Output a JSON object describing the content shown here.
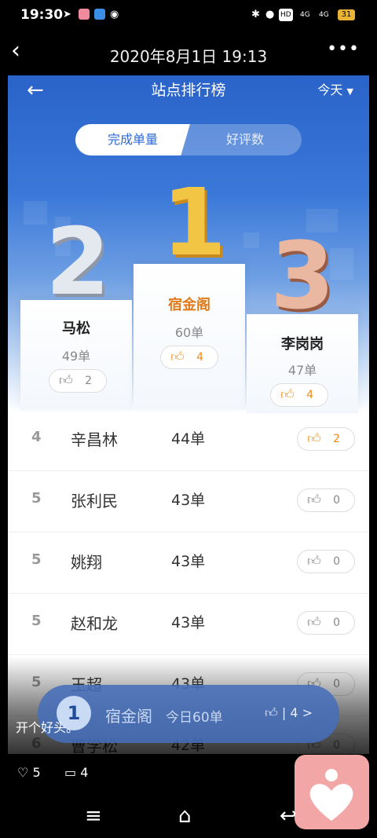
{
  "status_bar": {
    "time": "19:30",
    "network": "4G",
    "network2": "4G",
    "battery": "31",
    "hd": "HD"
  },
  "post_header": {
    "back_icon": "chevron-left-icon",
    "title": "2020年8月1日 19:13",
    "more_icon": "more-dots-icon"
  },
  "app": {
    "back_icon": "arrow-left-icon",
    "title": "站点排行榜",
    "period": "今天",
    "tabs": [
      {
        "label": "完成单量",
        "active": true
      },
      {
        "label": "好评数",
        "active": false
      }
    ],
    "podium": [
      {
        "rank": "2",
        "name": "马松",
        "count": "49单",
        "likes": "2",
        "liked": false
      },
      {
        "rank": "1",
        "name": "宿金阁",
        "count": "60单",
        "likes": "4",
        "liked": true
      },
      {
        "rank": "3",
        "name": "李岗岗",
        "count": "47单",
        "likes": "4",
        "liked": true
      }
    ],
    "rows": [
      {
        "rank": "4",
        "name": "辛昌林",
        "count": "44单",
        "likes": "2",
        "liked": true
      },
      {
        "rank": "5",
        "name": "张利民",
        "count": "43单",
        "likes": "0",
        "liked": false
      },
      {
        "rank": "5",
        "name": "姚翔",
        "count": "43单",
        "likes": "0",
        "liked": false
      },
      {
        "rank": "5",
        "name": "赵和龙",
        "count": "43单",
        "likes": "0",
        "liked": false
      },
      {
        "rank": "5",
        "name": "王超",
        "count": "43单",
        "likes": "0",
        "liked": false
      },
      {
        "rank": "6",
        "name": "曹学松",
        "count": "42单",
        "likes": "0",
        "liked": false
      }
    ],
    "my_rank": {
      "rank": "1",
      "name": "宿金阁",
      "today": "今日60单",
      "likes": "| 4 >"
    }
  },
  "caption": "开个好头。",
  "social": {
    "likes": "5",
    "comments": "4"
  },
  "colors": {
    "brand_blue": "#2d6ad6",
    "like_orange": "#f5941e",
    "rank1_gold": "#e07a1a"
  }
}
